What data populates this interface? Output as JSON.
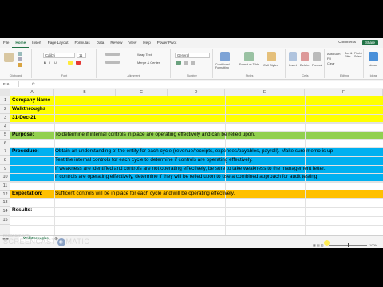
{
  "ribbon_tabs": [
    "File",
    "Home",
    "Insert",
    "Page Layout",
    "Formulas",
    "Data",
    "Review",
    "View",
    "Help",
    "Power Pivot"
  ],
  "active_tab": "Home",
  "ribbon": {
    "comments_label": "Comments",
    "share_label": "Share",
    "font_name": "Calibri",
    "font_size": "11",
    "wrap_text": "Wrap Text",
    "merge_center": "Merge & Center",
    "number_format": "General",
    "conditional_formatting": "Conditional Formatting",
    "format_as_table": "Format as Table",
    "cell_styles": "Cell Styles",
    "insert": "Insert",
    "delete": "Delete",
    "format": "Format",
    "autosum": "AutoSum",
    "fill": "Fill",
    "clear": "Clear",
    "sort_filter": "Sort & Filter",
    "find_select": "Find & Select",
    "ideas": "Ideas",
    "groups": [
      "Clipboard",
      "Font",
      "Alignment",
      "Number",
      "Styles",
      "Cells",
      "Editing",
      "Ideas"
    ]
  },
  "formula_bar": {
    "name_box": "F16",
    "fx": "fx",
    "content": ""
  },
  "columns": [
    "A",
    "B",
    "C",
    "D",
    "E",
    "F"
  ],
  "rows": [
    "1",
    "2",
    "3",
    "4",
    "5",
    "6",
    "7",
    "8",
    "9",
    "10",
    "11",
    "12",
    "13",
    "14",
    "15"
  ],
  "cells": {
    "company_name": "Company Name",
    "walkthroughs": "Walkthroughs",
    "date": "31-Dec-21",
    "purpose_label": "Purpose:",
    "purpose_text": "To determine if internal controls in place are operating effectively and can be relied upon.",
    "procedure_label": "Procedure:",
    "procedure_line1": "Obtain an understanding of the entity for each cycle (revenue/receipts, expenses/payables, payroll).  Make sure memo is up",
    "procedure_line2": "Test the internal controls for each cycle to determine if controls are operating effectively.",
    "procedure_line3": "If weakness are identified and controls are not operating effectively, be sure to take weakness to the management letter.",
    "procedure_line4": "If controls are operating effectively, determine if they will be relied upon to use a combined approach for audit testing.",
    "expectation_label": "Expectation:",
    "expectation_text": "Sufficent controls will be in place for each cycle and will be operating effectively.",
    "results_label": "Results:"
  },
  "sheet_tab": "Walkthroughs",
  "zoom": "100%",
  "watermark": {
    "recorded_with": "RECORDED WITH",
    "brand_left": "SCREENCAST",
    "brand_right": "MATIC"
  },
  "colors": {
    "yellow": "#ffff00",
    "green": "#92d050",
    "blue": "#00b0f0",
    "orange": "#ffc000",
    "excel_green": "#217346"
  }
}
